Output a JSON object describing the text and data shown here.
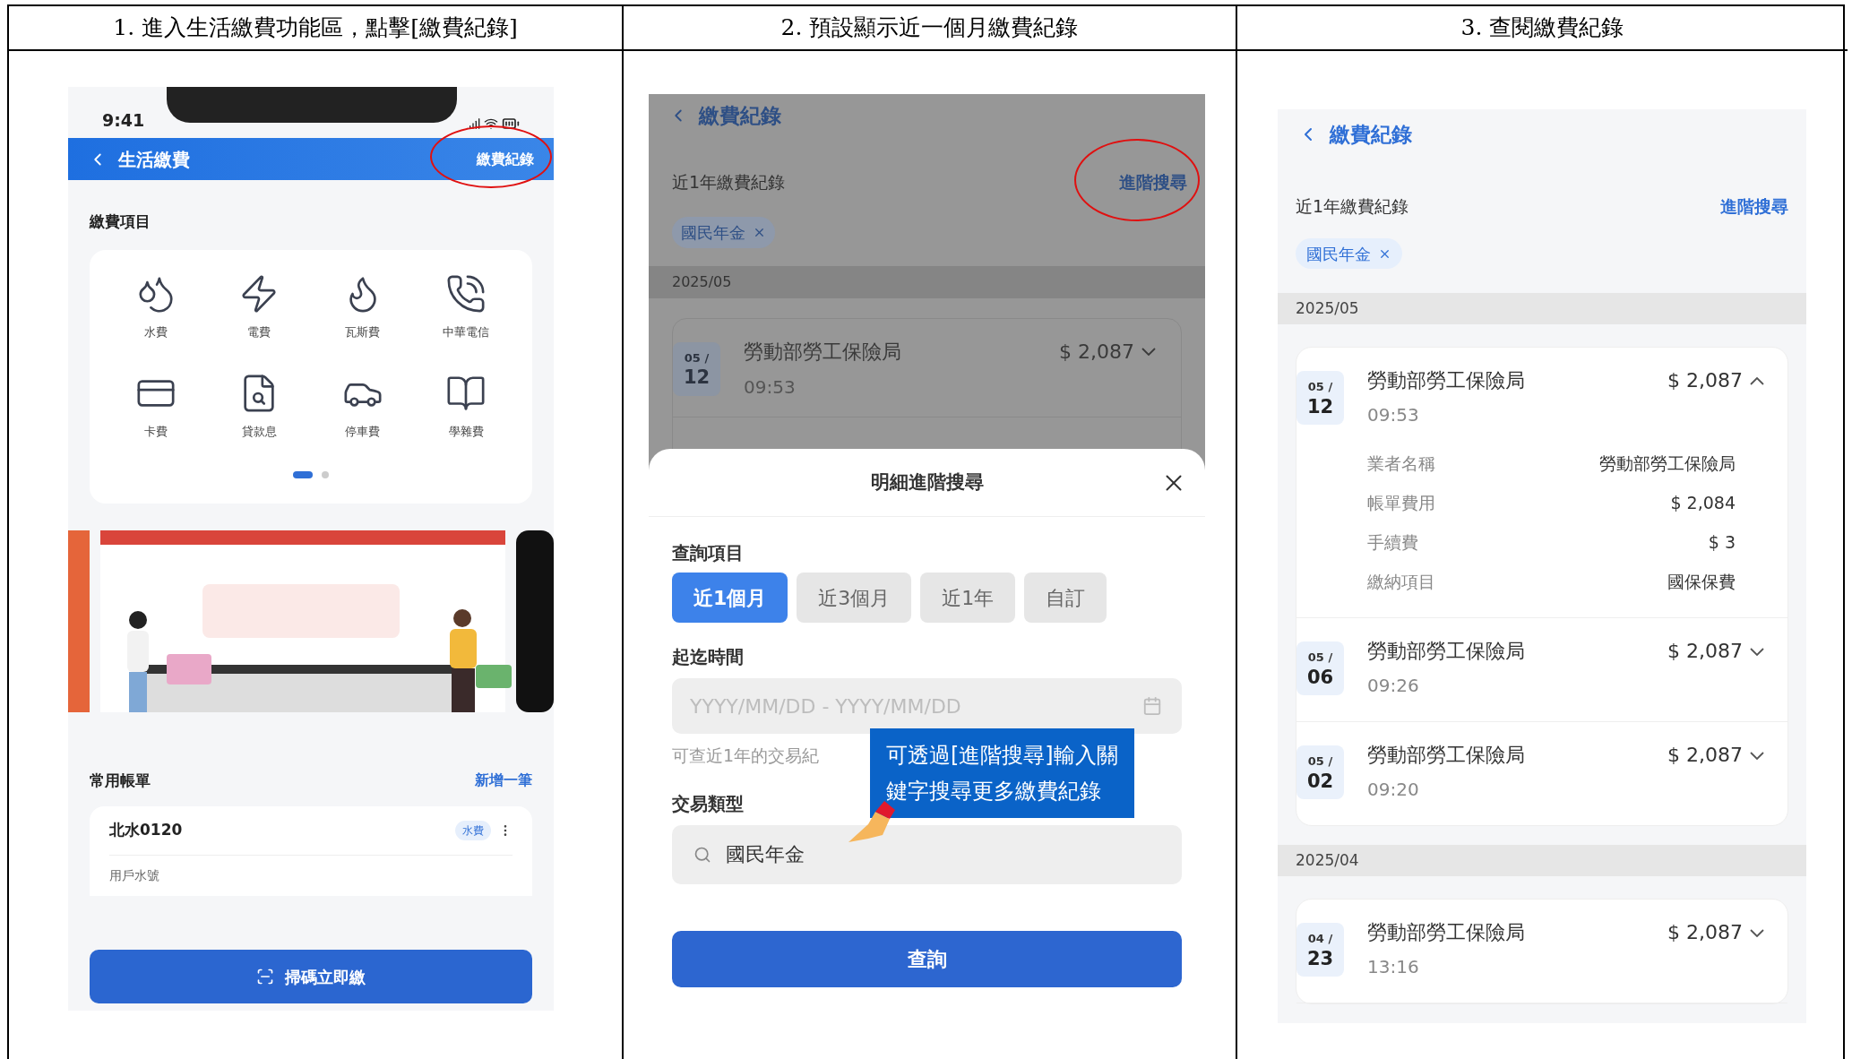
{
  "steps": [
    {
      "heading": "1.  進入生活繳費功能區，點擊[繳費紀錄]"
    },
    {
      "heading": "2.  預設顯示近一個月繳費紀錄"
    },
    {
      "heading": "3.  查閱繳費紀錄"
    }
  ],
  "screen_1": {
    "status_time": "9:41",
    "nav_title": "生活繳費",
    "nav_action": "繳費紀錄",
    "action_circled": true,
    "section_title": "繳費項目",
    "services": [
      {
        "label": "水費",
        "kind": "water"
      },
      {
        "label": "電費",
        "kind": "electric"
      },
      {
        "label": "瓦斯費",
        "kind": "gas"
      },
      {
        "label": "中華電信",
        "kind": "phone"
      },
      {
        "label": "卡費",
        "kind": "card"
      },
      {
        "label": "貸款息",
        "kind": "loan"
      },
      {
        "label": "停車費",
        "kind": "parking"
      },
      {
        "label": "學雜費",
        "kind": "tuition"
      }
    ],
    "pager": [
      {
        "selected": true
      },
      {
        "selected": false
      }
    ],
    "bills_title": "常用帳單",
    "bills_action": "新增一筆",
    "bill": {
      "name": "北水0120",
      "tag": "水費",
      "field_label": "用戶水號"
    },
    "scan_button": "掃碼立即繳"
  },
  "screen_2": {
    "back_title": "繳費紀錄",
    "range_label": "近1年繳費紀錄",
    "advanced_link": "進階搜尋",
    "link_circled": true,
    "filter_chip": "國民年金",
    "month": "2025/05",
    "record": {
      "month": "05 /",
      "day": "12",
      "payee": "勞動部勞工保險局",
      "amount": "$ 2,087",
      "time": "09:53"
    },
    "sheet": {
      "title": "明細進階搜尋",
      "period_label": "查詢項目",
      "periods": [
        {
          "label": "近1個月",
          "selected": true
        },
        {
          "label": "近3個月",
          "selected": false
        },
        {
          "label": "近1年",
          "selected": false
        },
        {
          "label": "自訂",
          "selected": false
        }
      ],
      "date_label": "起迄時間",
      "date_placeholder": "YYYY/MM/DD - YYYY/MM/DD",
      "date_hint": "可查近1年的交易紀",
      "type_label": "交易類型",
      "type_value": "國民年金",
      "submit": "查詢"
    },
    "callout": {
      "lines": [
        "可透過[進階搜尋]輸入關",
        "鍵字搜尋更多繳費紀錄"
      ]
    }
  },
  "screen_3": {
    "back_title": "繳費紀錄",
    "range_label": "近1年繳費紀錄",
    "advanced_link": "進階搜尋",
    "filter_chip": "國民年金",
    "groups": [
      {
        "month": "2025/05",
        "records": [
          {
            "month": "05 /",
            "day": "12",
            "payee": "勞動部勞工保險局",
            "amount": "$ 2,087",
            "time": "09:53",
            "expanded": true,
            "details": [
              {
                "label": "業者名稱",
                "value": "勞動部勞工保險局"
              },
              {
                "label": "帳單費用",
                "value": "$ 2,084"
              },
              {
                "label": "手續費",
                "value": "$ 3"
              },
              {
                "label": "繳納項目",
                "value": "國保保費"
              }
            ]
          },
          {
            "month": "05 /",
            "day": "06",
            "payee": "勞動部勞工保險局",
            "amount": "$ 2,087",
            "time": "09:26",
            "expanded": false
          },
          {
            "month": "05 /",
            "day": "02",
            "payee": "勞動部勞工保險局",
            "amount": "$ 2,087",
            "time": "09:20",
            "expanded": false
          }
        ]
      },
      {
        "month": "2025/04",
        "records": [
          {
            "month": "04 /",
            "day": "23",
            "payee": "勞動部勞工保險局",
            "amount": "$ 2,087",
            "time": "13:16",
            "expanded": false
          }
        ]
      }
    ]
  }
}
